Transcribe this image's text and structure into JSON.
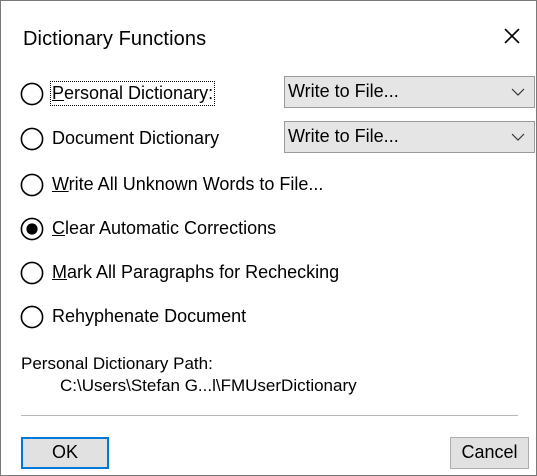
{
  "dialog": {
    "title": "Dictionary Functions",
    "close_icon": "close-icon",
    "selected_option": "clear_corrections",
    "options": {
      "personal_dictionary": {
        "prefix": "",
        "accel": "P",
        "rest": "ersonal Dictionary:",
        "selected": false
      },
      "document_dictionary": {
        "prefix": "",
        "accel": "",
        "rest": "Document Dictionary",
        "selected": false
      },
      "write_unknown": {
        "prefix": "",
        "accel": "W",
        "rest": "rite All Unknown Words to File...",
        "selected": false
      },
      "clear_corrections": {
        "prefix": "",
        "accel": "C",
        "rest": "lear Automatic Corrections",
        "selected": true
      },
      "mark_paragraphs": {
        "prefix": "",
        "accel": "M",
        "rest": "ark All Paragraphs for Rechecking",
        "selected": false
      },
      "rehyphenate": {
        "prefix": "",
        "accel": "",
        "rest": "Rehyphenate Document",
        "selected": false
      }
    },
    "personal_dict_select": {
      "value": "Write to File..."
    },
    "document_dict_select": {
      "value": "Write to File..."
    },
    "path_label": "Personal Dictionary Path:",
    "path_value": "C:\\Users\\Stefan G...l\\FMUserDictionary",
    "ok_label": "OK",
    "cancel_label": "Cancel"
  }
}
